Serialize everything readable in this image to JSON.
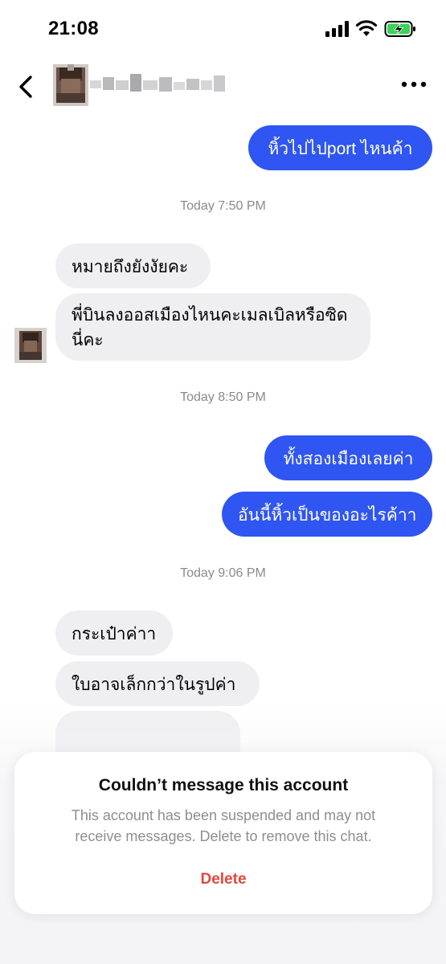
{
  "status_bar": {
    "time": "21:08"
  },
  "header": {
    "contact_name": "",
    "more_icon": "ellipsis-icon",
    "back_icon": "chevron-left-icon"
  },
  "messages": [
    {
      "from": "me",
      "text": "หิ้วไปไปport ไหนค้า"
    },
    {
      "timestamp": "Today 7:50 PM"
    },
    {
      "from": "them",
      "text": "หมายถึงยังงัยคะ"
    },
    {
      "from": "them",
      "text_line1": "พี่บินลงออสเมืองไหนคะเมลเบิลหรือซิด",
      "text_line2": "นี่คะ"
    },
    {
      "timestamp": "Today 8:50 PM"
    },
    {
      "from": "me",
      "text": "ทั้งสองเมืองเลยค่า"
    },
    {
      "from": "me",
      "text": "อันนี้หิ้วเป็นของอะไรค้าา"
    },
    {
      "timestamp": "Today 9:06 PM"
    },
    {
      "from": "them",
      "text": "กระเป๋าค่าา"
    },
    {
      "from": "them",
      "text": "ใบอาจเล็กกว่าในรูปค่า"
    }
  ],
  "alert": {
    "title": "Couldn’t message this account",
    "body_line1": "This account has been suspended and may not",
    "body_line2": "receive messages. Delete to remove this chat.",
    "delete_label": "Delete"
  },
  "colors": {
    "outgoing": "#2f55f2",
    "incoming": "#efeff1",
    "danger": "#e2463c"
  }
}
